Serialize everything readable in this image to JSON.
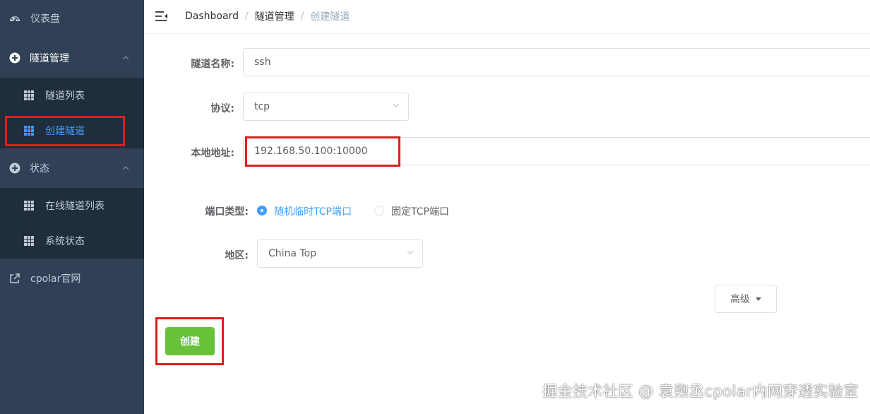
{
  "sidebar": {
    "dashboard": {
      "label": "仪表盘",
      "icon": "dashboard-icon"
    },
    "tunnel_mgmt": {
      "label": "隧道管理",
      "icon": "plus-circle-icon",
      "items": [
        {
          "label": "隧道列表",
          "icon": "grid-icon"
        },
        {
          "label": "创建隧道",
          "icon": "grid-icon",
          "active": true
        }
      ]
    },
    "status": {
      "label": "状态",
      "icon": "plus-circle-icon",
      "items": [
        {
          "label": "在线隧道列表",
          "icon": "grid-icon"
        },
        {
          "label": "系统状态",
          "icon": "grid-icon"
        }
      ]
    },
    "cpolar_site": {
      "label": "cpolar官网",
      "icon": "external-link-icon"
    }
  },
  "breadcrumb": {
    "home": "Dashboard",
    "section": "隧道管理",
    "current": "创建隧道",
    "separator": "/"
  },
  "form": {
    "name": {
      "label": "隧道名称:",
      "value": "ssh"
    },
    "protocol": {
      "label": "协议:",
      "value": "tcp"
    },
    "local_addr": {
      "label": "本地地址:",
      "value": "192.168.50.100:10000"
    },
    "port_type": {
      "label": "端口类型:",
      "options": [
        {
          "label": "随机临时TCP端口",
          "checked": true
        },
        {
          "label": "固定TCP端口",
          "checked": false
        }
      ]
    },
    "region": {
      "label": "地区:",
      "value": "China Top"
    },
    "advanced_label": "高级",
    "create_label": "创建"
  },
  "watermark": "掘金技术社区 @ 袁煦丞cpolar内网穿透实验室",
  "colors": {
    "sidebar_bg": "#304156",
    "submenu_bg": "#1f2d3d",
    "active_text": "#409eff",
    "create_button": "#67c23a",
    "highlight_box": "#d9201f"
  }
}
